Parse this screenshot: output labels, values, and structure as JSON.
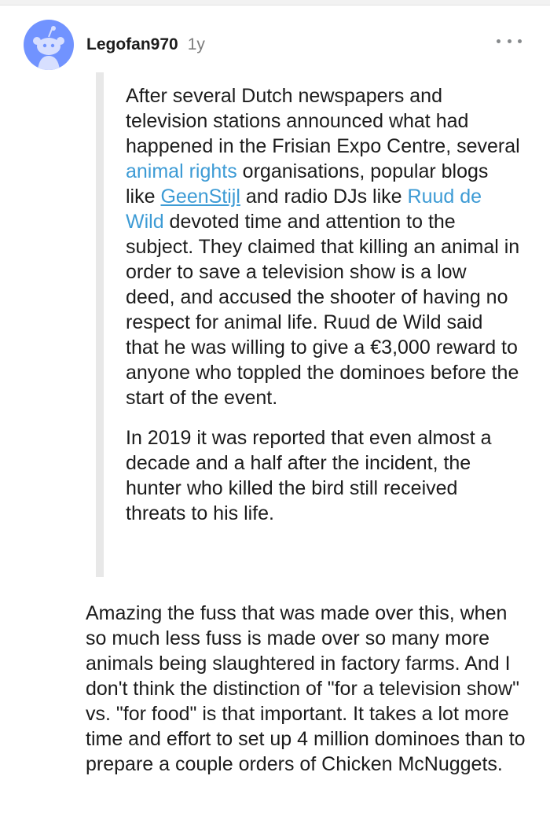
{
  "comment": {
    "username": "Legofan970",
    "age": "1y",
    "avatar_icon": "reddit-snoo-icon",
    "more_icon": "more-options-icon",
    "quote": {
      "p1": {
        "t1": "After several Dutch newspapers and television stations announced what had happened in the Frisian Expo Centre, several ",
        "link1": "animal rights",
        "t2": " organisations, popular blogs like ",
        "link2": "GeenStijl",
        "t3": " and radio DJs like ",
        "link3": "Ruud de Wild",
        "t4": " devoted time and attention to the subject. They claimed that killing an animal in order to save a television show is a low deed, and accused the shooter of having no respect for animal life. Ruud de Wild said that he was willing to give a €3,000 reward to anyone who toppled the dominoes before the start of the event."
      },
      "p2": "In 2019 it was reported that even almost a decade and a half after the incident, the hunter who killed the bird still received threats to his life."
    },
    "body": "Amazing the fuss that was made over this, when so much less fuss is made over so many more animals being slaughtered in factory farms. And I don't think the distinction of \"for a television show\" vs. \"for food\" is that important. It takes a lot more time and effort to set up 4 million dominoes than to prepare a couple orders of Chicken McNuggets."
  },
  "colors": {
    "link": "#3d9bd5",
    "avatar_bg": "#7193ff",
    "quote_bar": "#e8e8e8",
    "meta_text": "#7c7c7c"
  }
}
